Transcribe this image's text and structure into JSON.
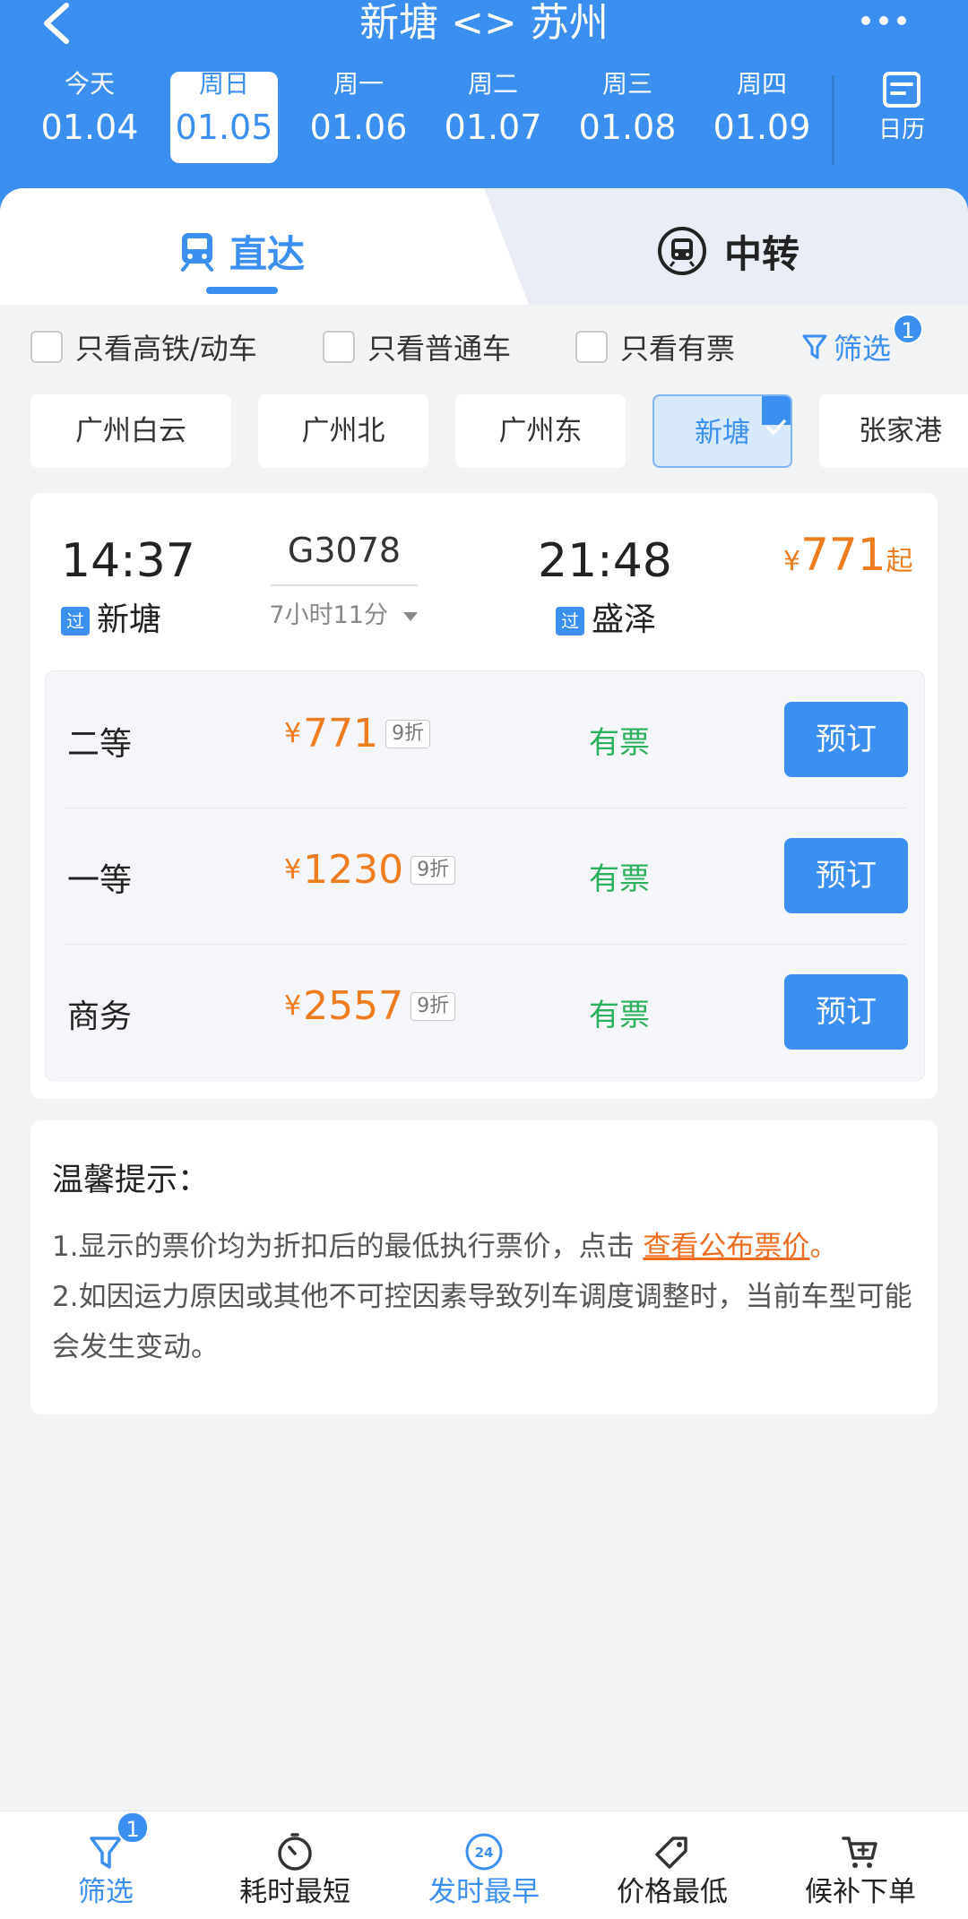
{
  "header": {
    "title": "新塘 <> 苏州"
  },
  "dates": [
    {
      "weekday": "今天",
      "date": "01.04"
    },
    {
      "weekday": "周日",
      "date": "01.05"
    },
    {
      "weekday": "周一",
      "date": "01.06"
    },
    {
      "weekday": "周二",
      "date": "01.07"
    },
    {
      "weekday": "周三",
      "date": "01.08"
    },
    {
      "weekday": "周四",
      "date": "01.09"
    }
  ],
  "calendar_label": "日历",
  "tabs": {
    "direct": "直达",
    "transfer": "中转"
  },
  "filters": {
    "high_speed": "只看高铁/动车",
    "regular": "只看普通车",
    "available": "只看有票",
    "filter_label": "筛选",
    "filter_count": "1"
  },
  "stations": [
    "广州白云",
    "广州北",
    "广州东",
    "新塘",
    "张家港"
  ],
  "train": {
    "dep_time": "14:37",
    "arr_time": "21:48",
    "number": "G3078",
    "duration": "7小时11分",
    "dep_station": "新塘",
    "arr_station": "盛泽",
    "station_tag": "过",
    "min_price_currency": "¥",
    "min_price": "771",
    "min_price_suffix": "起",
    "seats": [
      {
        "name": "二等",
        "currency": "¥",
        "price": "771",
        "discount": "9折",
        "status": "有票",
        "button": "预订"
      },
      {
        "name": "一等",
        "currency": "¥",
        "price": "1230",
        "discount": "9折",
        "status": "有票",
        "button": "预订"
      },
      {
        "name": "商务",
        "currency": "¥",
        "price": "2557",
        "discount": "9折",
        "status": "有票",
        "button": "预订"
      }
    ]
  },
  "tips": {
    "title": "温馨提示：",
    "line1_prefix": "1.显示的票价均为折扣后的最低执行票价，点击 ",
    "line1_link": "查看公布票价",
    "line1_suffix": "。",
    "line2": "2.如因运力原因或其他不可控因素导致列车调度调整时，当前车型可能会发生变动。"
  },
  "bottom_bar": {
    "filter": "筛选",
    "filter_count": "1",
    "shortest": "耗时最短",
    "earliest": "发时最早",
    "cheapest": "价格最低",
    "waitlist": "候补下单",
    "clock24": "24"
  },
  "colors": {
    "brand_blue": "#3a8ff0",
    "price_orange": "#ef7c1f",
    "available_green": "#2bb15e"
  }
}
